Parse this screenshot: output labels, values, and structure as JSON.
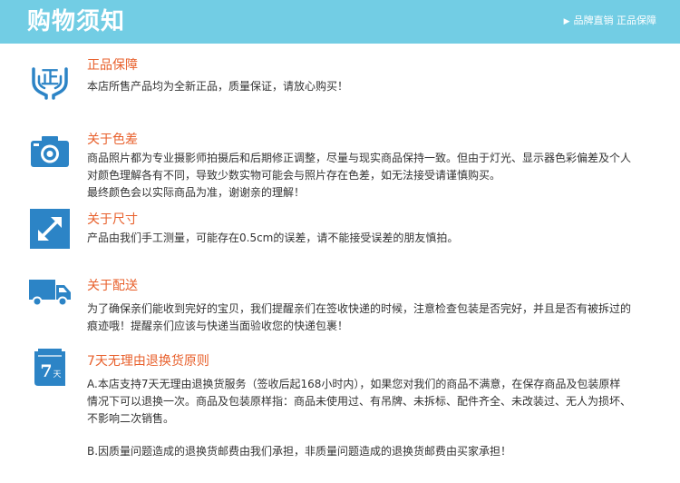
{
  "header": {
    "title": "购物须知",
    "tag": "品牌直销 正品保障",
    "tag_arrow": "▶"
  },
  "colors": {
    "header_bg": "#72cde4",
    "icon_blue": "#2c84c6",
    "title_orange": "#e8602c"
  },
  "sections": [
    {
      "icon": "genuine-hands-icon",
      "icon_text": "正",
      "title": "正品保障",
      "lines": [
        "本店所售产品均为全新正品，质量保证，请放心购买！"
      ]
    },
    {
      "icon": "camera-icon",
      "title": "关于色差",
      "lines": [
        "商品照片都为专业摄影师拍摄后和后期修正调整，尽量与现实商品保持一致。但由于灯光、显示器色彩偏差及个人",
        "对颜色理解各有不同，导致少数实物可能会与照片存在色差，如无法接受请谨慎购买。",
        "最终颜色会以实际商品为准，谢谢亲的理解！"
      ]
    },
    {
      "icon": "resize-arrow-icon",
      "title": "关于尺寸",
      "lines": [
        "产品由我们手工测量，可能存在0.5cm的误差，请不能接受误差的朋友慎拍。"
      ]
    },
    {
      "icon": "delivery-truck-icon",
      "title": "关于配送",
      "lines": [
        "为了确保亲们能收到完好的宝贝，我们提醒亲们在签收快递的时候，注意检查包装是否完好，并且是否有被拆过的",
        "痕迹哦！提醒亲们应该与快递当面验收您的快递包裹！"
      ]
    },
    {
      "icon": "calendar-7-days-icon",
      "icon_text": "7",
      "icon_subtext": "天",
      "title": "7天无理由退换货原则",
      "lines": [
        "A.本店支持7天无理由退换货服务（签收后起168小时内），如果您对我们的商品不满意，在保存商品及包装原样",
        "情况下可以退换一次。商品及包装原样指：商品未使用过、有吊牌、未拆标、配件齐全、未改装过、无人为损坏、",
        "不影响二次销售。"
      ],
      "extra_line": "B.因质量问题造成的退换货邮费由我们承担，非质量问题造成的退换货邮费由买家承担！"
    }
  ]
}
